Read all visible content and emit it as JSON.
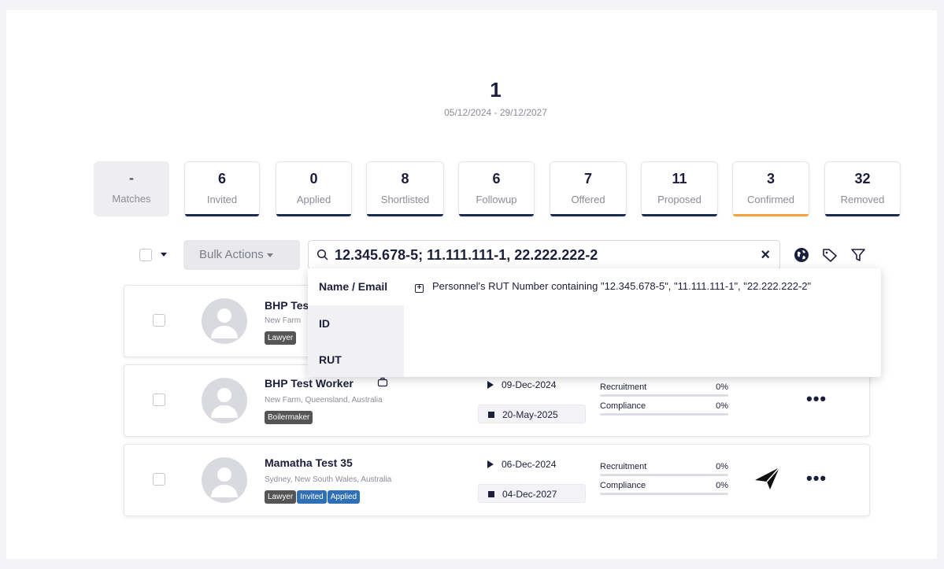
{
  "header": {
    "number": "1",
    "date_range": "05/12/2024 - 29/12/2027"
  },
  "stages": [
    {
      "count": "-",
      "label": "Matches"
    },
    {
      "count": "6",
      "label": "Invited"
    },
    {
      "count": "0",
      "label": "Applied"
    },
    {
      "count": "8",
      "label": "Shortlisted"
    },
    {
      "count": "6",
      "label": "Followup"
    },
    {
      "count": "7",
      "label": "Offered"
    },
    {
      "count": "11",
      "label": "Proposed"
    },
    {
      "count": "3",
      "label": "Confirmed"
    },
    {
      "count": "32",
      "label": "Removed"
    }
  ],
  "toolbar": {
    "bulk_actions_label": "Bulk Actions",
    "search_value": "12.345.678-5; 11.111.111-1, 22.222.222-2",
    "clear_label": "×",
    "icons": [
      "globe-icon",
      "tag-icon",
      "filter-icon"
    ]
  },
  "search_dropdown": {
    "tabs": [
      "Name / Email",
      "ID",
      "RUT"
    ],
    "option": "Personnel's RUT Number containing \"12.345.678-5\", \"11.111.111-1\", \"22.222.222-2\""
  },
  "candidates": [
    {
      "name": "BHP Test",
      "location": "New Farm",
      "tags": [
        {
          "label": "Lawyer",
          "kind": "role"
        }
      ]
    },
    {
      "name": "BHP Test Worker",
      "location": "New Farm, Queensland, Australia",
      "tags": [
        {
          "label": "Boilermaker",
          "kind": "role"
        }
      ],
      "start_date": "09-Dec-2024",
      "end_date": "20-May-2025",
      "recruitment_label": "Recruitment",
      "recruitment_pct": "0%",
      "compliance_label": "Compliance",
      "compliance_pct": "0%",
      "more_label": "•••"
    },
    {
      "name": "Mamatha Test 35",
      "location": "Sydney, New South Wales, Australia",
      "tags": [
        {
          "label": "Lawyer",
          "kind": "role"
        },
        {
          "label": "Invited",
          "kind": "status"
        },
        {
          "label": "Applied",
          "kind": "status"
        }
      ],
      "start_date": "06-Dec-2024",
      "end_date": "04-Dec-2027",
      "recruitment_label": "Recruitment",
      "recruitment_pct": "0%",
      "compliance_label": "Compliance",
      "compliance_pct": "0%",
      "more_label": "•••"
    }
  ],
  "colors": {
    "navy": "#1b1f3b",
    "confirmed_accent": "#f2a33a",
    "status_tag": "#2e6fb6",
    "role_tag": "#555555"
  }
}
